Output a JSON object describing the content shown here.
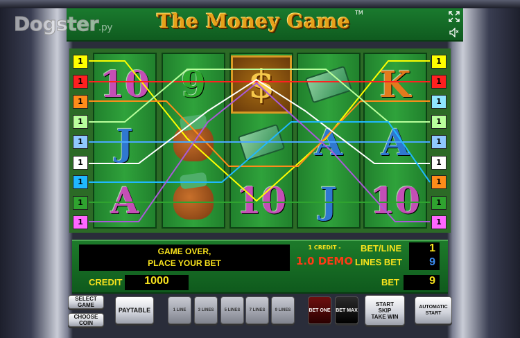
{
  "window": {
    "watermark": "Dogster",
    "watermark_suffix": ".ру"
  },
  "game": {
    "title": "The Money Game",
    "trademark": "TM",
    "reels": [
      [
        {
          "type": "letter",
          "text": "10",
          "color": "#c44fb6"
        },
        {
          "type": "letter",
          "text": "J",
          "color": "#2f78d0"
        },
        {
          "type": "letter",
          "text": "A",
          "color": "#c44fb6"
        }
      ],
      [
        {
          "type": "letter",
          "text": "9",
          "color": "#2ea82e"
        },
        {
          "type": "bag",
          "text": ""
        },
        {
          "type": "cash",
          "text": ""
        }
      ],
      [
        {
          "type": "dollar",
          "text": "$"
        },
        {
          "type": "cash",
          "text": ""
        },
        {
          "type": "letter",
          "text": "10",
          "color": "#c44fb6"
        }
      ],
      [
        {
          "type": "cash",
          "text": ""
        },
        {
          "type": "letter",
          "text": "A",
          "color": "#2f78d0"
        },
        {
          "type": "letter",
          "text": "J",
          "color": "#2f78d0"
        }
      ],
      [
        {
          "type": "letter",
          "text": "K",
          "color": "#e27a1d"
        },
        {
          "type": "letter",
          "text": "A",
          "color": "#2f78d0"
        },
        {
          "type": "letter",
          "text": "10",
          "color": "#c44fb6"
        }
      ]
    ],
    "left_line_labels": [
      {
        "text": "1",
        "color": "#ffff00"
      },
      {
        "text": "1",
        "color": "#ff2020"
      },
      {
        "text": "1",
        "color": "#ff8c1a"
      },
      {
        "text": "1",
        "color": "#b9ff9c"
      },
      {
        "text": "1",
        "color": "#8fc8ff"
      },
      {
        "text": "1",
        "color": "#ffffff"
      },
      {
        "text": "1",
        "color": "#1fb8ff"
      },
      {
        "text": "1",
        "color": "#2fa32f"
      },
      {
        "text": "1",
        "color": "#ff66ff"
      }
    ],
    "right_line_labels": [
      {
        "text": "1",
        "color": "#ffff00"
      },
      {
        "text": "1",
        "color": "#ff2020"
      },
      {
        "text": "1",
        "color": "#8fe6ff"
      },
      {
        "text": "1",
        "color": "#b9ff9c"
      },
      {
        "text": "1",
        "color": "#8fc8ff"
      },
      {
        "text": "1",
        "color": "#ffffff"
      },
      {
        "text": "1",
        "color": "#ff8c1a"
      },
      {
        "text": "1",
        "color": "#2fa32f"
      },
      {
        "text": "1",
        "color": "#ff66ff"
      }
    ]
  },
  "panel": {
    "message_line1": "GAME OVER,",
    "message_line2": "PLACE YOUR BET",
    "credit_rate": "1 CREDIT -",
    "demo": "1.0 DEMO",
    "bet_line_label": "BET/LINE",
    "bet_line_value": "1",
    "lines_bet_label": "LINES BET",
    "lines_bet_value": "9",
    "credit_label": "CREDIT",
    "credit_value": "1000",
    "bet_label": "BET",
    "bet_value": "9"
  },
  "buttons": {
    "select_game": "SELECT GAME",
    "choose_coin": "CHOOSE COIN",
    "paytable": "PAYTABLE",
    "line1": "1 LINE",
    "line3": "3 LINES",
    "line5": "5 LINES",
    "line7": "7 LINES",
    "line9": "9 LINES",
    "bet_one": "BET ONE",
    "bet_max": "BET MAX",
    "start": "START",
    "skip": "SKIP",
    "take_win": "TAKE WIN",
    "automatic_start": "AUTOMATIC START"
  },
  "icons": {
    "fullscreen": "fullscreen-icon",
    "sound": "speaker-icon"
  }
}
